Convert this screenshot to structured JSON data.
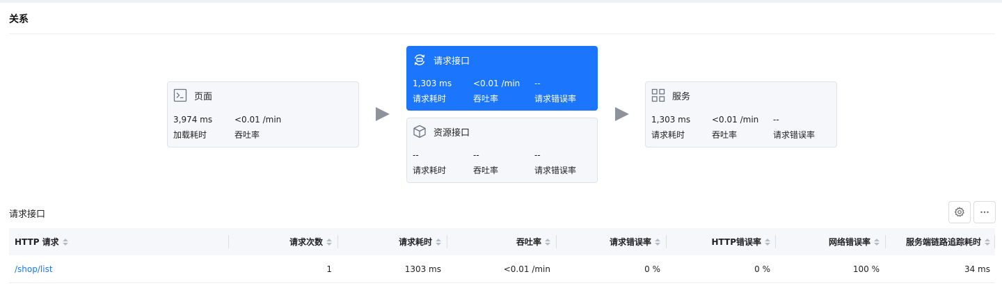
{
  "section": {
    "title": "关系"
  },
  "flow": {
    "page": {
      "name": "页面",
      "icon": "terminal-icon",
      "metrics": [
        {
          "value": "3,974 ms",
          "label": "加载耗时"
        },
        {
          "value": "<0.01 /min",
          "label": "吞吐率"
        }
      ]
    },
    "request_api": {
      "name": "请求接口",
      "icon": "api-icon",
      "active": true,
      "metrics": [
        {
          "value": "1,303 ms",
          "label": "请求耗时"
        },
        {
          "value": "<0.01 /min",
          "label": "吞吐率"
        },
        {
          "value": "--",
          "label": "请求错误率"
        }
      ]
    },
    "resource_api": {
      "name": "资源接口",
      "icon": "cube-icon",
      "metrics": [
        {
          "value": "--",
          "label": "请求耗时"
        },
        {
          "value": "--",
          "label": "吞吐率"
        },
        {
          "value": "--",
          "label": "请求错误率"
        }
      ]
    },
    "service": {
      "name": "服务",
      "icon": "grid-icon",
      "metrics": [
        {
          "value": "1,303 ms",
          "label": "请求耗时"
        },
        {
          "value": "<0.01 /min",
          "label": "吞吐率"
        },
        {
          "value": "--",
          "label": "请求错误率"
        }
      ]
    }
  },
  "table": {
    "title": "请求接口",
    "columns": [
      "HTTP 请求",
      "请求次数",
      "请求耗时",
      "吞吐率",
      "请求错误率",
      "HTTP错误率",
      "网络错误率",
      "服务端链路追踪耗时"
    ],
    "rows": [
      [
        "/shop/list",
        "1",
        "1303 ms",
        "<0.01 /min",
        "0 %",
        "0 %",
        "100 %",
        "34 ms"
      ]
    ]
  },
  "colors": {
    "accent": "#1c76fd",
    "card_bg": "#f5f7fa",
    "arrow": "#8e939b"
  }
}
